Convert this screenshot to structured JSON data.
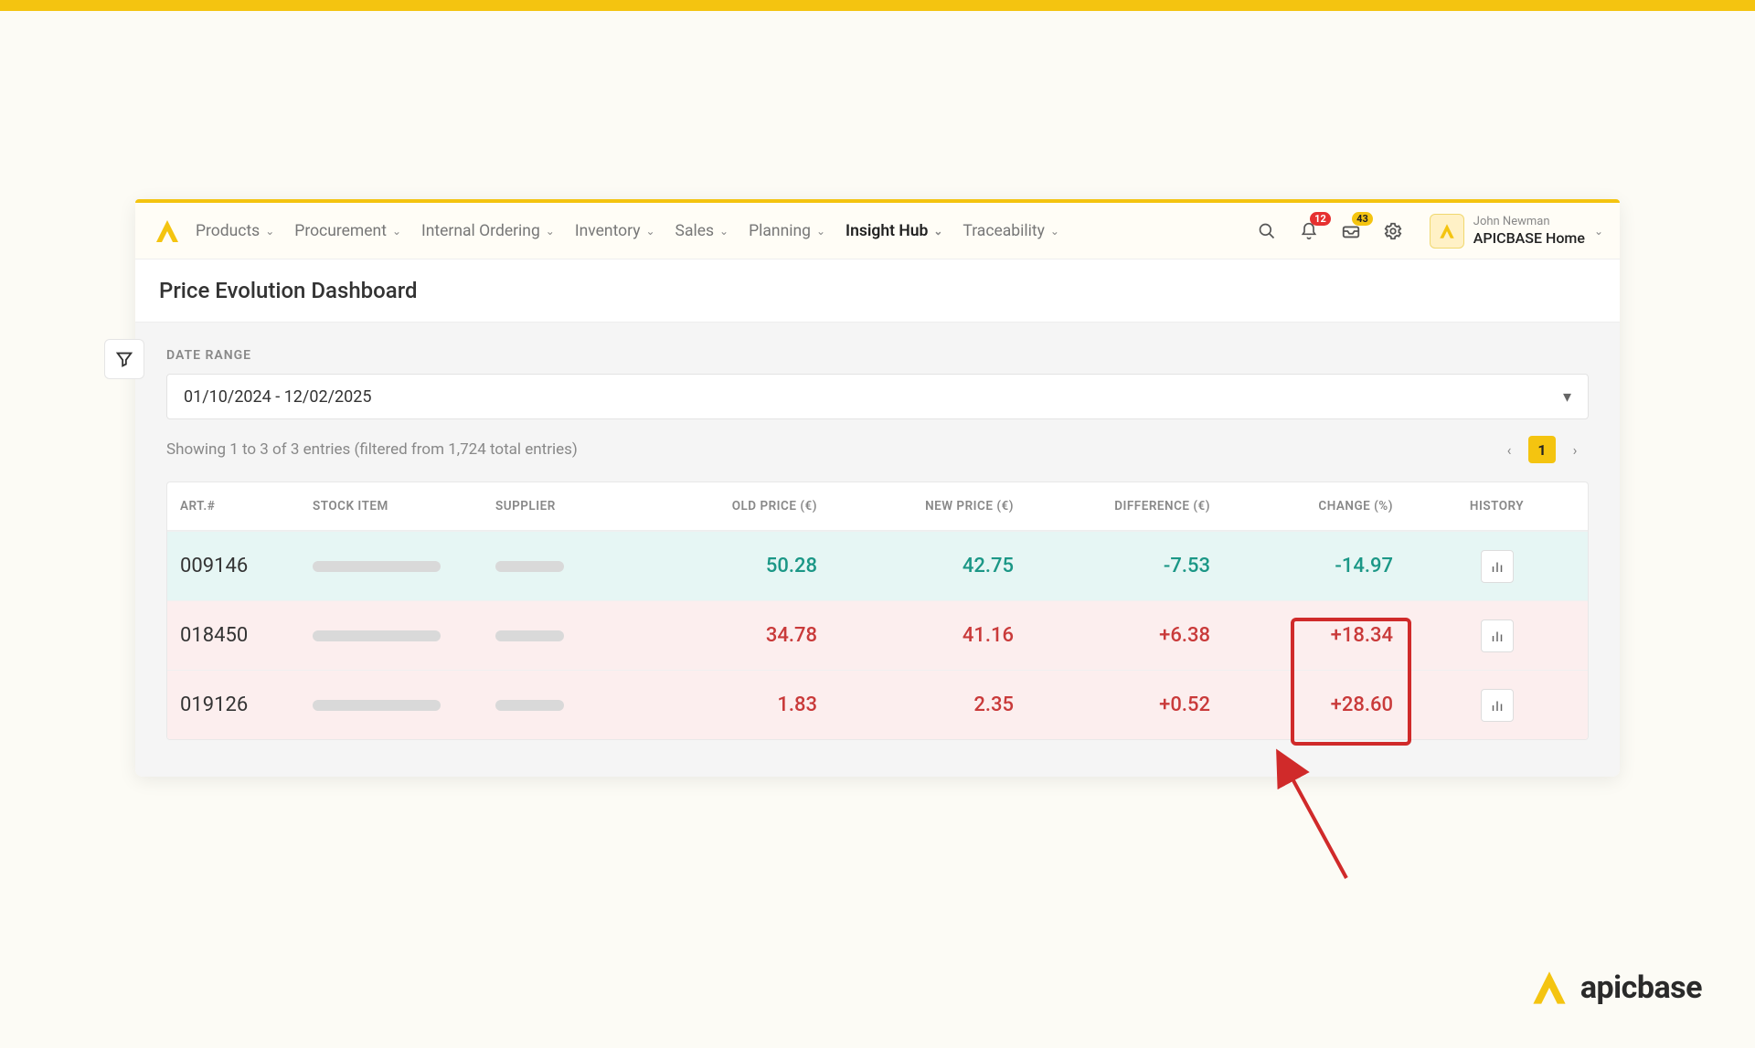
{
  "nav": {
    "items": [
      {
        "label": "Products"
      },
      {
        "label": "Procurement"
      },
      {
        "label": "Internal Ordering"
      },
      {
        "label": "Inventory"
      },
      {
        "label": "Sales"
      },
      {
        "label": "Planning"
      },
      {
        "label": "Insight Hub",
        "active": true
      },
      {
        "label": "Traceability"
      }
    ],
    "badges": {
      "notifications": "12",
      "tasks": "43"
    },
    "user": {
      "name": "John Newman",
      "org": "APICBASE Home"
    }
  },
  "page": {
    "title": "Price Evolution Dashboard",
    "date_range_label": "DATE RANGE",
    "date_range_value": "01/10/2024 - 12/02/2025",
    "entries_text": "Showing 1 to 3 of 3 entries (filtered from 1,724 total entries)",
    "current_page": "1"
  },
  "table": {
    "headers": {
      "art": "ART.#",
      "stock": "STOCK ITEM",
      "supplier": "SUPPLIER",
      "old": "OLD PRICE (€)",
      "new": "NEW PRICE (€)",
      "diff": "DIFFERENCE (€)",
      "change": "CHANGE (%)",
      "history": "HISTORY"
    },
    "rows": [
      {
        "art": "009146",
        "old": "50.28",
        "new": "42.75",
        "diff": "-7.53",
        "change": "-14.97",
        "tone": "green"
      },
      {
        "art": "018450",
        "old": "34.78",
        "new": "41.16",
        "diff": "+6.38",
        "change": "+18.34",
        "tone": "red"
      },
      {
        "art": "019126",
        "old": "1.83",
        "new": "2.35",
        "diff": "+0.52",
        "change": "+28.60",
        "tone": "red"
      }
    ]
  },
  "brand": "apicbase"
}
